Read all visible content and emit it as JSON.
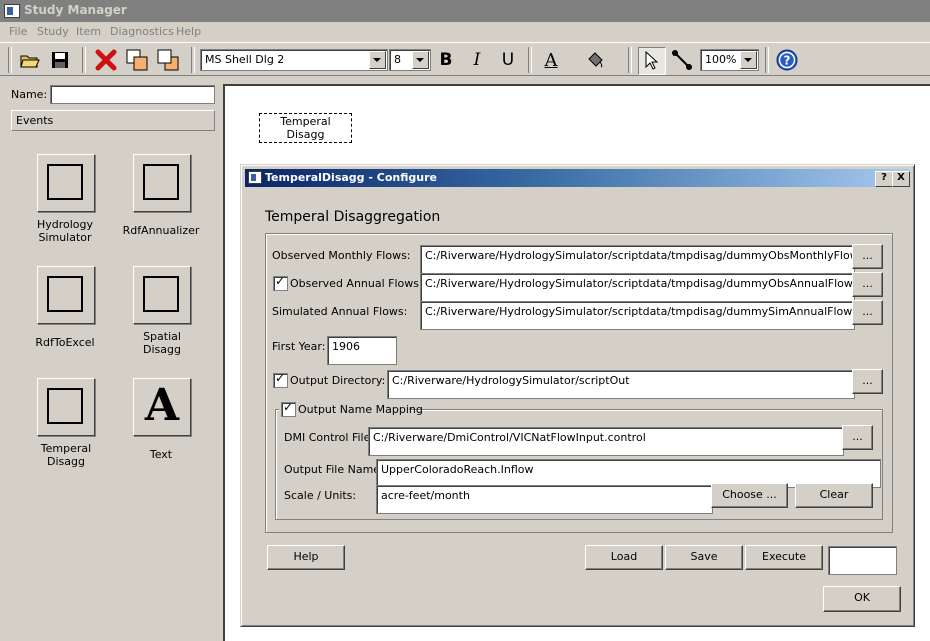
{
  "app": {
    "title": "Study Manager"
  },
  "menu": [
    "File",
    "Study",
    "Item",
    "Diagnostics",
    "Help"
  ],
  "toolbar": {
    "font": "MS Shell Dlg 2",
    "size": "8",
    "bold": "B",
    "italic": "I",
    "underline": "U",
    "text_color_glyph": "A",
    "zoom": "100%"
  },
  "left": {
    "name_label": "Name:",
    "name_value": "",
    "events_header": "Events",
    "palette": [
      {
        "label": "Hydrology Simulator"
      },
      {
        "label": "RdfAnnualizer"
      },
      {
        "label": "RdfToExcel"
      },
      {
        "label": "Spatial Disagg"
      },
      {
        "label": "Temperal Disagg"
      },
      {
        "label": "Text",
        "glyph": "A"
      }
    ]
  },
  "canvas": {
    "node_label": "Temperal Disagg"
  },
  "dialog": {
    "title": "TemperalDisagg - Configure",
    "help_glyph": "?",
    "close_glyph": "X",
    "heading": "Temperal Disaggregation",
    "observed_monthly": {
      "label": "Observed Monthly Flows:",
      "value": "C:/Riverware/HydrologySimulator/scriptdata/tmpdisag/dummyObsMonthlyFlows.txt"
    },
    "observed_annual": {
      "label": "Observed Annual Flows:",
      "value": "C:/Riverware/HydrologySimulator/scriptdata/tmpdisag/dummyObsAnnualFlows.txt",
      "checked": true
    },
    "simulated_annual": {
      "label": "Simulated Annual Flows:",
      "value": "C:/Riverware/HydrologySimulator/scriptdata/tmpdisag/dummySimAnnualFlows.txt"
    },
    "browse": "...",
    "first_year": {
      "label": "First Year:",
      "value": "1906"
    },
    "output_dir": {
      "label": "Output Directory:",
      "value": "C:/Riverware/HydrologySimulator/scriptOut",
      "checked": true
    },
    "mapping": {
      "title": "Output Name Mapping",
      "checked": true,
      "dmi": {
        "label": "DMI Control File:",
        "value": "C:/Riverware/DmiControl/VICNatFlowInput.control"
      },
      "output_name": {
        "label": "Output File Name:",
        "value": "UpperColoradoReach.Inflow"
      },
      "scale": {
        "label": "Scale / Units:",
        "value": "acre-feet/month"
      },
      "choose": "Choose ...",
      "clear": "Clear"
    },
    "buttons": {
      "help": "Help",
      "load": "Load",
      "save": "Save",
      "execute": "Execute",
      "ok": "OK"
    }
  }
}
